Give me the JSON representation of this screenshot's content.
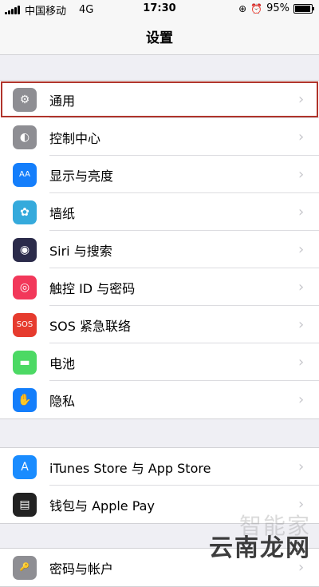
{
  "status_bar": {
    "carrier": "中国移动",
    "network": "4G",
    "time": "17:30",
    "battery": "95%",
    "battery_level": 0.95
  },
  "nav": {
    "title": "设置"
  },
  "group1": [
    {
      "label": "通用",
      "icon": "gear-icon",
      "color": "#8e8e93",
      "glyph": "⚙"
    },
    {
      "label": "控制中心",
      "icon": "toggles-icon",
      "color": "#8e8e93",
      "glyph": "◐"
    },
    {
      "label": "显示与亮度",
      "icon": "text-size-icon",
      "color": "#147efb",
      "glyph": "AA"
    },
    {
      "label": "墙纸",
      "icon": "flower-icon",
      "color": "#35aadc",
      "glyph": "✿"
    },
    {
      "label": "Siri 与搜索",
      "icon": "siri-icon",
      "color": "#2b2b4a",
      "glyph": "◉"
    },
    {
      "label": "触控 ID 与密码",
      "icon": "fingerprint-icon",
      "color": "#f2385a",
      "glyph": "◎"
    },
    {
      "label": "SOS 紧急联络",
      "icon": "sos-icon",
      "color": "#e63b2e",
      "glyph": "SOS"
    },
    {
      "label": "电池",
      "icon": "battery-icon",
      "color": "#4cd964",
      "glyph": "▬"
    },
    {
      "label": "隐私",
      "icon": "hand-icon",
      "color": "#147efb",
      "glyph": "✋"
    }
  ],
  "group2": [
    {
      "label": "iTunes Store 与 App Store",
      "icon": "app-store-icon",
      "color": "#1a8cff",
      "glyph": "A"
    },
    {
      "label": "钱包与 Apple Pay",
      "icon": "wallet-icon",
      "color": "#222222",
      "glyph": "▤"
    }
  ],
  "group3": [
    {
      "label": "密码与帐户",
      "icon": "key-icon",
      "color": "#8e8e93",
      "glyph": "🔑"
    }
  ],
  "watermark": {
    "main": "云南龙网",
    "faint": "智能家"
  }
}
